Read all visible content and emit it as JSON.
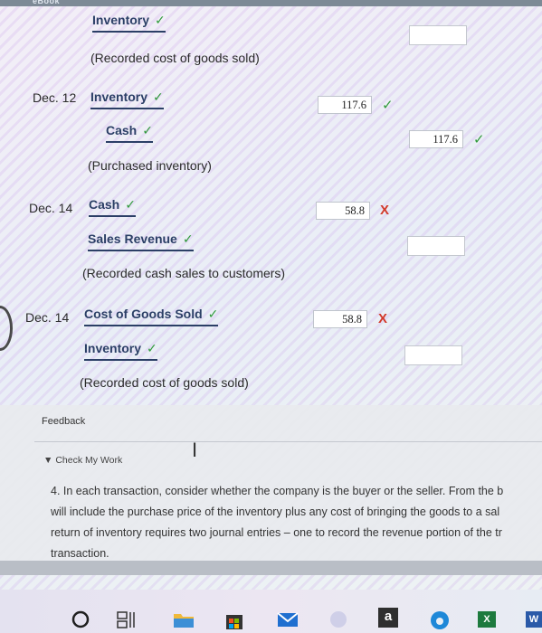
{
  "topbar": {
    "label": "eBook"
  },
  "entries": [
    {
      "date": "",
      "debit_account": "Inventory",
      "debit_amount": "",
      "credit_account": "",
      "credit_amount": "",
      "memo": "(Recorded cost of goods sold)"
    },
    {
      "date": "Dec. 12",
      "debit_account": "Inventory",
      "debit_amount": "117.6",
      "credit_account": "Cash",
      "credit_amount": "117.6",
      "memo": "(Purchased inventory)"
    },
    {
      "date": "Dec. 14",
      "debit_account": "Cash",
      "debit_amount": "58.8",
      "credit_account": "Sales Revenue",
      "credit_amount": "",
      "memo": "(Recorded cash sales to customers)"
    },
    {
      "date": "Dec. 14",
      "debit_account": "Cost of Goods Sold",
      "debit_amount": "58.8",
      "credit_account": "Inventory",
      "credit_amount": "",
      "memo": "(Recorded cost of goods sold)"
    }
  ],
  "marks": {
    "correct": "✓",
    "incorrect": "X"
  },
  "feedback": {
    "title": "Feedback",
    "check_label": "Check My Work",
    "lines": [
      "4. In each transaction, consider whether the company is the buyer or the seller. From the b",
      "will include the purchase price of the inventory plus any cost of bringing the goods to a sal",
      "return of inventory requires two journal entries – one to record the revenue portion of the tr",
      "transaction."
    ]
  },
  "taskbar": {
    "amazon_label": "a",
    "excel_label": "X",
    "word_label": "W"
  },
  "colors": {
    "account": "#2b3f66",
    "correct": "#2f9a3a",
    "incorrect": "#d2392b"
  }
}
